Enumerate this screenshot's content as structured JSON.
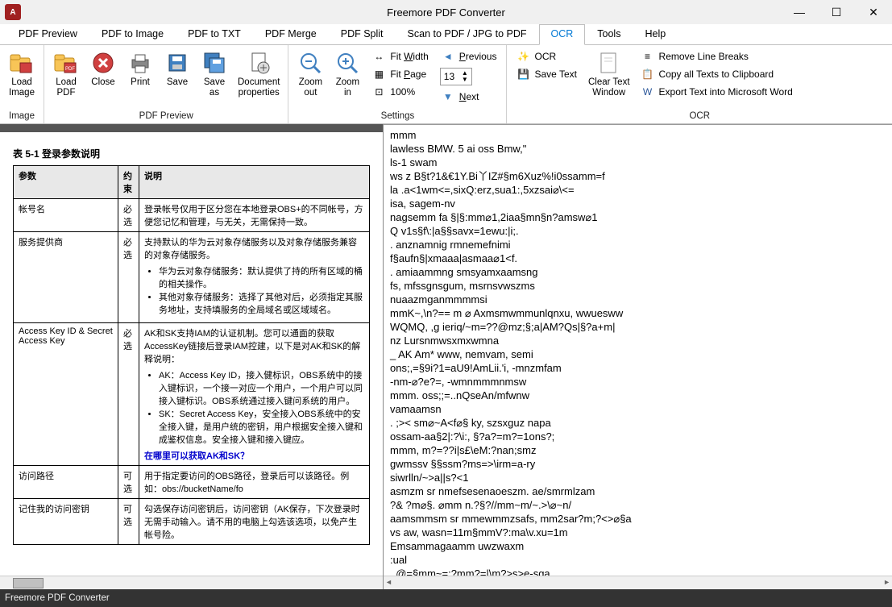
{
  "window": {
    "title": "Freemore PDF Converter",
    "icon_letter": "A"
  },
  "tabs": [
    {
      "label": "PDF Preview"
    },
    {
      "label": "PDF to Image"
    },
    {
      "label": "PDF to TXT"
    },
    {
      "label": "PDF Merge"
    },
    {
      "label": "PDF Split"
    },
    {
      "label": "Scan to PDF / JPG to PDF"
    },
    {
      "label": "OCR",
      "active": true
    },
    {
      "label": "Tools"
    },
    {
      "label": "Help"
    }
  ],
  "ribbon": {
    "groups": {
      "image": {
        "label": "Image",
        "buttons": {
          "load_image": "Load\nImage"
        }
      },
      "pdf_preview": {
        "label": "PDF Preview",
        "buttons": {
          "load_pdf": "Load\nPDF",
          "close": "Close",
          "print": "Print",
          "save": "Save",
          "save_as": "Save\nas",
          "doc_props": "Document\nproperties"
        }
      },
      "settings": {
        "label": "Settings",
        "buttons": {
          "zoom_out": "Zoom\nout",
          "zoom_in": "Zoom\nin"
        },
        "small": {
          "fit_width": "Fit Width",
          "fit_page": "Fit Page",
          "zoom100": "100%",
          "previous": "Previous",
          "next": "Next"
        },
        "page_value": "13"
      },
      "ocr": {
        "label": "OCR",
        "buttons": {
          "ocr": "OCR",
          "save_text": "Save Text",
          "clear_text": "Clear Text\nWindow"
        },
        "small": {
          "remove_breaks": "Remove Line Breaks",
          "copy_all": "Copy all Texts to Clipboard",
          "export_word": "Export Text into Microsoft Word"
        }
      }
    }
  },
  "pdf": {
    "caption": "表 5-1 登录参数说明",
    "headers": {
      "c1": "参数",
      "c2": "约\n束",
      "c3": "说明"
    },
    "rows": [
      {
        "c1": "帐号名",
        "c2": "必\n选",
        "c3": "登录帐号仅用于区分您在本地登录OBS+的不同帐号，方便您记忆和管理，与无关，无需保持一致。"
      },
      {
        "c1": "服务提供商",
        "c2": "必\n选",
        "c3_intro": "支持默认的华为云对象存储服务以及对象存储服务兼容的对象存储服务。",
        "c3_items": [
          "华为云对象存储服务：默认提供了持的所有区域的桶的相关操作。",
          "其他对象存储服务：选择了其他对后，必须指定其服务地址，支持填服务的全局域名或区域域名。"
        ]
      },
      {
        "c1": "Access Key ID & Secret Access Key",
        "c2": "必\n选",
        "c3_intro": "AK和SK支持IAM的认证机制。您可以通面的获取AccessKey链接后登录IAM控建，以下是对AK和SK的解释说明：",
        "c3_items": [
          "AK：Access Key ID，接入健标识，OBS系统中的接入键标识，一个接一对应一个用户，一个用户可以同接入键标识。OBS系统通过接入键问系统的用户。",
          "SK：Secret Access Key，安全接入OBS系统中的安全接入键，是用户统的密钥，用户根据安全接入键和成鉴权信息。安全接入键和接入键应。"
        ],
        "c3_link": "在哪里可以获取AK和SK？"
      },
      {
        "c1": "访问路径",
        "c2": "可\n选",
        "c3": "用于指定要访问的OBS路径，登录后可以该路径。例如：obs://bucketName/fo"
      },
      {
        "c1": "记住我的访问密钥",
        "c2": "可\n选",
        "c3": "勾选保存访问密钥后，访问密钥（AK保存，下次登录时无需手动输入。请不用的电脑上勾选该选项，以免产生帐号险。"
      }
    ]
  },
  "ocr_text": "mmm\nlawless BMW. 5 ai oss Bmw,\"\nls-1 swam\nws z B§t?1&€1Y.Bi丫IZ#§m6Xuz%!i0ssamm=f\nla .a<1wm<=,sixQ:erz,sua1:,5xzsai⌀\\<=\nisa, sagem-nv\nnagsemm fa §|§:mm⌀1,2iaa§mn§n?amsw⌀1\nQ v1s§f\\:|a§§savx=1ewu:|i;.\n. anznamnig rmnemefnimi\nf§aufn§|xmaaa|asmaa⌀1<f.\n. amiaammng smsyamxaamsng\nfs, mfssgnsgum, msrnsvwszms\nnuaazmganmmmmsi\nmmK~,\\n?== m ⌀ Axmsmwmmunlqnxu, wwuesww\nWQMQ, ,g ieriq/~m=??@mz;§;a|AM?Qs|§?a+m|\nnz Lursnmwsxmxwmna\n_ AK Am* www, nemvam, semi\nons;,=§9i?1=aU9!AmLii.'i, -mnzmfam\n-nm-⌀?e?=, -wmnmmmnmsw\nmmm. oss;;=..nQseAn/mfwnw\nvamaamsn\n. ;>< sm⌀~A<f⌀§ ky, szsxguz napa\nossam-aa§2|:?\\i:, §?a?=m?=1ons?;\nmmm, m?=??i|s£\\eM:?nan;smz\ngwmssv §§ssm?ms=>\\irm=a-ry\nsiwrlln/~>a||s?<1\nasmzm sr nmefsesenaoeszm. ae/smrmlzam\n?& ?m⌀§. ⌀mm n.?§?//mm~m/~.>\\⌀~n/\naamsmmsm sr mmewmmzsafs, mm2sar?m;?<>⌀§a\nvs aw, wasn=11m§mmV?:ma\\v.xu=1m\nEmsammagaamm uwzwaxm\n:ual\n. @=§mm~=;?mm?=|\\m?>s>e-sga,\n_ m?=zmm~mmwn=.;nm=m. =.;a=~⌀ven⌀|mmm=.",
  "statusbar": {
    "text": "Freemore PDF Converter"
  }
}
